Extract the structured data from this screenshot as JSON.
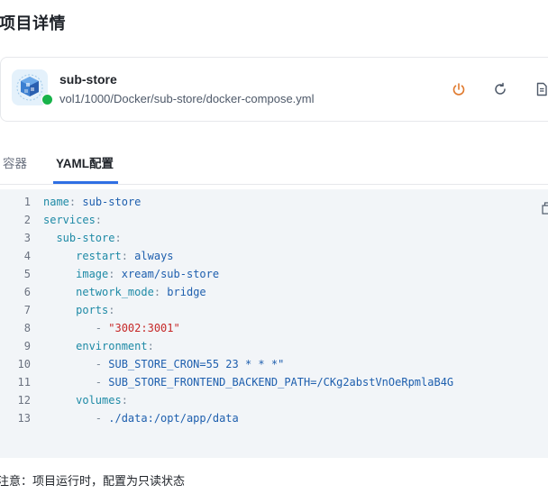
{
  "page": {
    "title": "项目详情"
  },
  "project": {
    "name": "sub-store",
    "path": "vol1/1000/Docker/sub-store/docker-compose.yml",
    "status_color": "#17b34a",
    "actions": [
      "power-icon",
      "refresh-icon",
      "document-icon"
    ]
  },
  "tabs": {
    "items": [
      {
        "label": "容器",
        "active": false
      },
      {
        "label": "YAML配置",
        "active": true
      }
    ],
    "accent": "#2f6fe4"
  },
  "code": {
    "lines": [
      {
        "n": "1",
        "indent": "",
        "key": "name",
        "value": "sub-store",
        "kind": "kv"
      },
      {
        "n": "2",
        "indent": "",
        "key": "services",
        "value": "",
        "kind": "kv"
      },
      {
        "n": "3",
        "indent": "  ",
        "key": "sub-store",
        "value": "",
        "kind": "kv"
      },
      {
        "n": "4",
        "indent": "     ",
        "key": "restart",
        "value": "always",
        "kind": "kv"
      },
      {
        "n": "5",
        "indent": "     ",
        "key": "image",
        "value": "xream/sub-store",
        "kind": "kv"
      },
      {
        "n": "6",
        "indent": "     ",
        "key": "network_mode",
        "value": "bridge",
        "kind": "kv"
      },
      {
        "n": "7",
        "indent": "     ",
        "key": "ports",
        "value": "",
        "kind": "kv"
      },
      {
        "n": "8",
        "indent": "        ",
        "item": "\"3002:3001\"",
        "kind": "str-item"
      },
      {
        "n": "9",
        "indent": "     ",
        "key": "environment",
        "value": "",
        "kind": "kv"
      },
      {
        "n": "10",
        "indent": "        ",
        "item": "SUB_STORE_CRON=55 23 * * *\"",
        "kind": "item"
      },
      {
        "n": "11",
        "indent": "        ",
        "item": "SUB_STORE_FRONTEND_BACKEND_PATH=/CKg2abstVnOeRpmlaB4G",
        "kind": "item"
      },
      {
        "n": "12",
        "indent": "     ",
        "key": "volumes",
        "value": "",
        "kind": "kv"
      },
      {
        "n": "13",
        "indent": "        ",
        "item": "./data:/opt/app/data",
        "kind": "item"
      }
    ]
  },
  "notice": "注意：项目运行时，配置为只读状态"
}
